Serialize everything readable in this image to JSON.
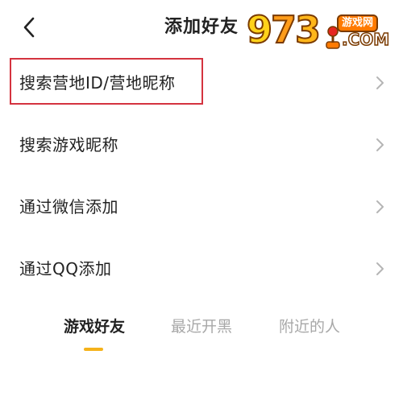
{
  "header": {
    "title": "添加好友",
    "back_icon": "chevron-left-icon"
  },
  "watermark": {
    "main": "97",
    "main_tail": "3",
    "badge": "游戏网",
    "suffix": ".COM"
  },
  "menu": {
    "items": [
      {
        "label": "搜索营地ID/营地昵称",
        "icon": "chevron-right-icon"
      },
      {
        "label": "搜索游戏昵称",
        "icon": "chevron-right-icon"
      },
      {
        "label": "通过微信添加",
        "icon": "chevron-right-icon"
      },
      {
        "label": "通过QQ添加",
        "icon": "chevron-right-icon"
      }
    ]
  },
  "tabs": {
    "items": [
      {
        "label": "游戏好友",
        "active": true
      },
      {
        "label": "最近开黑",
        "active": false
      },
      {
        "label": "附近的人",
        "active": false
      }
    ],
    "indicator_color": "#f5b21a"
  },
  "colors": {
    "highlight": "#d4333f",
    "text": "#222222",
    "muted": "#a8a8a8",
    "chevron": "#b5b5b5"
  }
}
